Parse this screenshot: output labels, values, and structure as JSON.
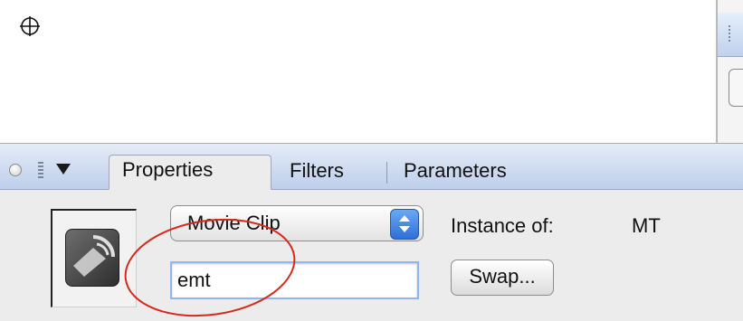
{
  "tabs": [
    {
      "label": "Properties",
      "active": true
    },
    {
      "label": "Filters",
      "active": false
    },
    {
      "label": "Parameters",
      "active": false
    }
  ],
  "symbol_type": {
    "selected": "Movie Clip"
  },
  "instance": {
    "label": "Instance of:",
    "value": "MT"
  },
  "instance_name": {
    "value": "emt"
  },
  "swap_button": {
    "label": "Swap..."
  },
  "colors": {
    "tab_bar": "#cddaf0",
    "panel_bg": "#ececec",
    "stepper": "#2f6fd6",
    "annotation": "#d7281c"
  },
  "icons": [
    "registration-point-icon",
    "panel-collapse-icon",
    "panel-grip-icon",
    "disclosure-triangle-icon",
    "movie-clip-symbol-icon",
    "select-stepper-icon"
  ]
}
